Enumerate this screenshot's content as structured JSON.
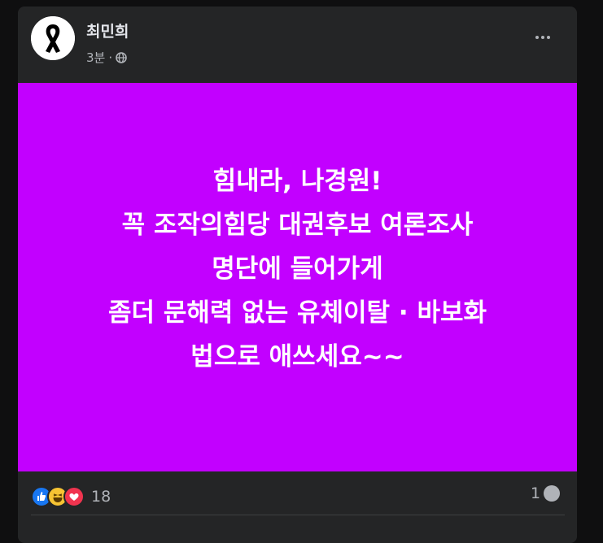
{
  "post": {
    "author": "최민희",
    "time": "3분",
    "separator": "·",
    "audience_icon": "globe-icon",
    "more_icon": "more-horizontal-icon",
    "background_color": "#c200ff",
    "lines": [
      "힘내라, 나경원!",
      "꼭 조작의힘당 대권후보 여론조사",
      "명단에 들어가게",
      "좀더 문해력 없는 유체이탈 · 바보화",
      "법으로 애쓰세요~~"
    ]
  },
  "footer": {
    "reaction_icons": [
      "like-icon",
      "haha-icon",
      "love-icon"
    ],
    "reaction_count": "18",
    "comment_count": "1",
    "comment_icon": "comment-bubble-icon"
  }
}
